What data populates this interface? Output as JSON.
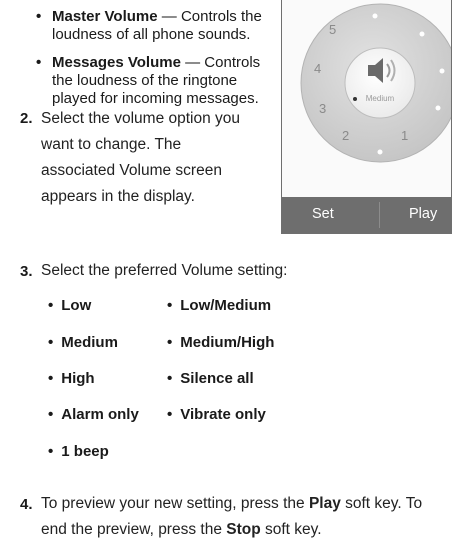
{
  "sub_bullets": [
    {
      "term": "Master Volume",
      "dash": " — ",
      "desc_line1": "Controls the",
      "desc_line2": "loudness of all phone sounds."
    },
    {
      "term": "Messages Volume",
      "dash": " — ",
      "desc_line1": "Controls",
      "desc_line2": "the loudness of the ringtone",
      "desc_line3": "played for incoming messages."
    }
  ],
  "step2": {
    "number": "2.",
    "line1": "Select the volume option you",
    "line2": "want to change. The",
    "line3": "associated Volume screen",
    "line4": "appears in the display."
  },
  "step3": {
    "number": "3.",
    "text": "Select the preferred Volume setting:",
    "options_left": [
      "Low",
      "Medium",
      "High",
      "Alarm only",
      "1 beep"
    ],
    "options_right": [
      "Low/Medium",
      "Medium/High",
      "Silence all",
      "Vibrate only"
    ]
  },
  "step4": {
    "number": "4.",
    "pre": "To preview your new setting, press the ",
    "play": "Play",
    "mid": " soft key. To",
    "line2_pre": "end the preview, press the ",
    "stop": "Stop",
    "post": " soft key."
  },
  "phone": {
    "dial_numbers": [
      "5",
      "4",
      "3",
      "2",
      "1"
    ],
    "center_label": "Medium",
    "softkey_left": "Set",
    "softkey_right": "Play",
    "icon": "speaker-volume-icon",
    "colors": {
      "softbar": "#6e6e6e",
      "dial": "#cfcfcf"
    }
  }
}
